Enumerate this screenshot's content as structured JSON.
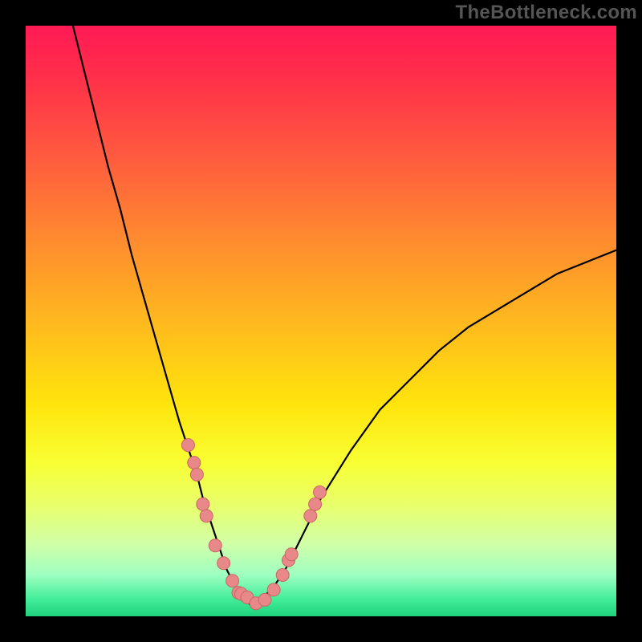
{
  "watermark": "TheBottleneck.com",
  "colors": {
    "frame": "#000000",
    "curve_stroke": "#000000",
    "marker_fill": "#e98888",
    "marker_stroke": "#c96666",
    "gradient_top": "#ff1a55",
    "gradient_bottom": "#1fd27c"
  },
  "chart_data": {
    "type": "line",
    "title": "",
    "xlabel": "",
    "ylabel": "",
    "xlim": [
      0,
      100
    ],
    "ylim": [
      0,
      100
    ],
    "grid": false,
    "legend": false,
    "series": [
      {
        "name": "curve",
        "x": [
          8,
          10,
          12,
          14,
          16,
          18,
          20,
          22,
          24,
          26,
          27,
          28,
          29,
          30,
          31,
          32,
          33,
          34,
          35,
          36,
          37,
          38,
          39,
          40,
          42,
          44,
          46,
          48,
          50,
          55,
          60,
          65,
          70,
          75,
          80,
          85,
          90,
          95,
          100
        ],
        "y": [
          100,
          92,
          84,
          76,
          69,
          61,
          54,
          47,
          40,
          33,
          30,
          27,
          24,
          20,
          17,
          14,
          11,
          8,
          6,
          4,
          3,
          2,
          2,
          3,
          5,
          8,
          12,
          16,
          20,
          28,
          35,
          40,
          45,
          49,
          52,
          55,
          58,
          60,
          62
        ]
      }
    ],
    "markers": {
      "name": "data-points",
      "x": [
        27.5,
        28.5,
        29.0,
        30.0,
        30.6,
        32.1,
        33.5,
        35.0,
        36.0,
        36.5,
        37.5,
        39.0,
        40.5,
        42.0,
        43.5,
        44.5,
        45.0,
        48.2,
        49.0,
        49.8
      ],
      "y": [
        29.0,
        26.0,
        24.0,
        19.0,
        17.0,
        12.0,
        9.0,
        6.0,
        4.0,
        3.8,
        3.2,
        2.2,
        2.8,
        4.5,
        7.0,
        9.5,
        10.5,
        17.0,
        19.0,
        21.0
      ]
    }
  }
}
